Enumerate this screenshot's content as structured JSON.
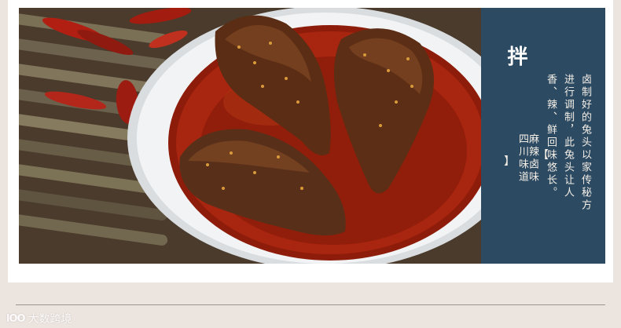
{
  "panel": {
    "title_char": "拌",
    "bracket_open": "【",
    "bracket_close": "】",
    "subtitle_part1": "麻辣卤味",
    "subtitle_part2": "四川味道",
    "desc_col1": "卤制好的兔头以家传秘方",
    "desc_col2": "进行调制，此兔头让人",
    "desc_col3": "香、辣、鲜回味悠长。"
  },
  "watermark": {
    "logo": "lOO",
    "text": "大数跨境"
  },
  "colors": {
    "panel_bg": "#2d4a63",
    "page_bg": "#ece4df",
    "chili_oil": "#a8250f"
  },
  "photo": {
    "subject": "spicy braised rabbit heads in chili oil, white bowl, dried chilies on bamboo mat"
  }
}
